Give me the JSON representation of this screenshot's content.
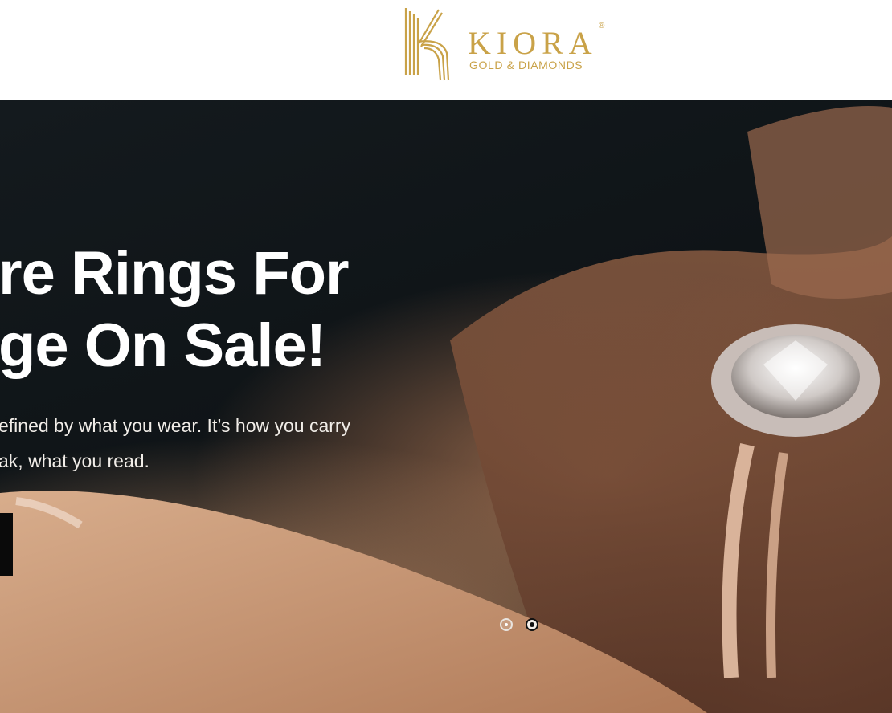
{
  "brand": {
    "name": "KIORA",
    "registered": "®",
    "tagline": "GOLD & DIAMONDS",
    "color": "#c9a248"
  },
  "hero": {
    "headline_line1": "re Rings For",
    "headline_line2": "ge On Sale!",
    "subtext_line1": "efined by what you wear. It’s how you carry",
    "subtext_line2": "ak, what you read.",
    "image": "hand-with-diamond-ring"
  },
  "slider": {
    "slides": 2,
    "active_slide": 2
  }
}
